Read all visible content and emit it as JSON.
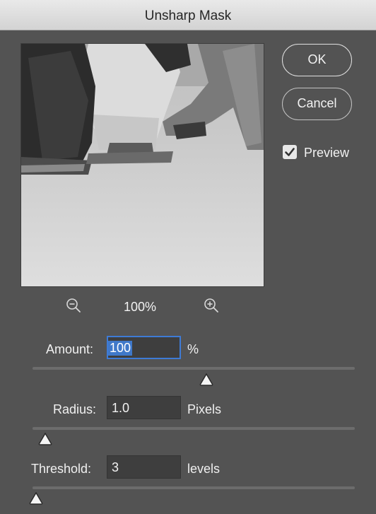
{
  "window": {
    "title": "Unsharp Mask"
  },
  "buttons": {
    "ok": "OK",
    "cancel": "Cancel"
  },
  "preview": {
    "label": "Preview",
    "checked": true,
    "zoom_level": "100%",
    "zoom_out_icon": "zoom-out-icon",
    "zoom_in_icon": "zoom-in-icon"
  },
  "amount": {
    "label": "Amount:",
    "value": "100",
    "unit": "%",
    "slider_fraction": 0.54,
    "focused": true
  },
  "radius": {
    "label": "Radius:",
    "value": "1.0",
    "unit": "Pixels",
    "slider_fraction": 0.04
  },
  "threshold": {
    "label": "Threshold:",
    "value": "3",
    "unit": "levels",
    "slider_fraction": 0.01
  },
  "colors": {
    "background": "#535353",
    "focus": "#3e7bd6",
    "selection": "#3f78c9"
  }
}
